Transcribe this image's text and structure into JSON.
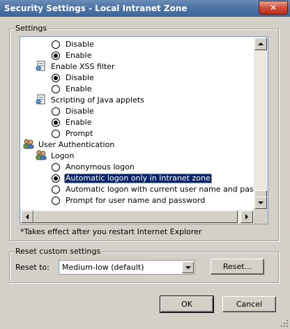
{
  "window": {
    "title": "Security Settings - Local Intranet Zone",
    "close_glyph": "✕"
  },
  "settings": {
    "legend": "Settings",
    "rows": [
      {
        "kind": "radio",
        "label": "Disable",
        "checked": false
      },
      {
        "kind": "radio",
        "label": "Enable",
        "checked": true
      },
      {
        "kind": "category",
        "label": "Enable XSS filter",
        "icon": "settings-page-icon"
      },
      {
        "kind": "radio",
        "label": "Disable",
        "checked": true
      },
      {
        "kind": "radio",
        "label": "Enable",
        "checked": false
      },
      {
        "kind": "category",
        "label": "Scripting of Java applets",
        "icon": "settings-page-icon"
      },
      {
        "kind": "radio",
        "label": "Disable",
        "checked": false
      },
      {
        "kind": "radio",
        "label": "Enable",
        "checked": true
      },
      {
        "kind": "radio",
        "label": "Prompt",
        "checked": false
      },
      {
        "kind": "category",
        "label": "User Authentication",
        "icon": "users-icon"
      },
      {
        "kind": "category",
        "label": "Logon",
        "icon": "users-icon"
      },
      {
        "kind": "radio",
        "label": "Anonymous logon",
        "checked": false
      },
      {
        "kind": "radio",
        "label": "Automatic logon only in Intranet zone",
        "checked": true,
        "selected": true
      },
      {
        "kind": "radio",
        "label": "Automatic logon with current user name and password",
        "checked": false
      },
      {
        "kind": "radio",
        "label": "Prompt for user name and password",
        "checked": false
      }
    ],
    "note": "*Takes effect after you restart Internet Explorer"
  },
  "reset": {
    "legend": "Reset custom settings",
    "label": "Reset to:",
    "selected_value": "Medium-low (default)",
    "button_label": "Reset..."
  },
  "footer": {
    "ok_label": "OK",
    "cancel_label": "Cancel"
  },
  "colors": {
    "selection": "#0a246a",
    "titlebar": "#4f75a6",
    "close_button": "#c8412a"
  }
}
